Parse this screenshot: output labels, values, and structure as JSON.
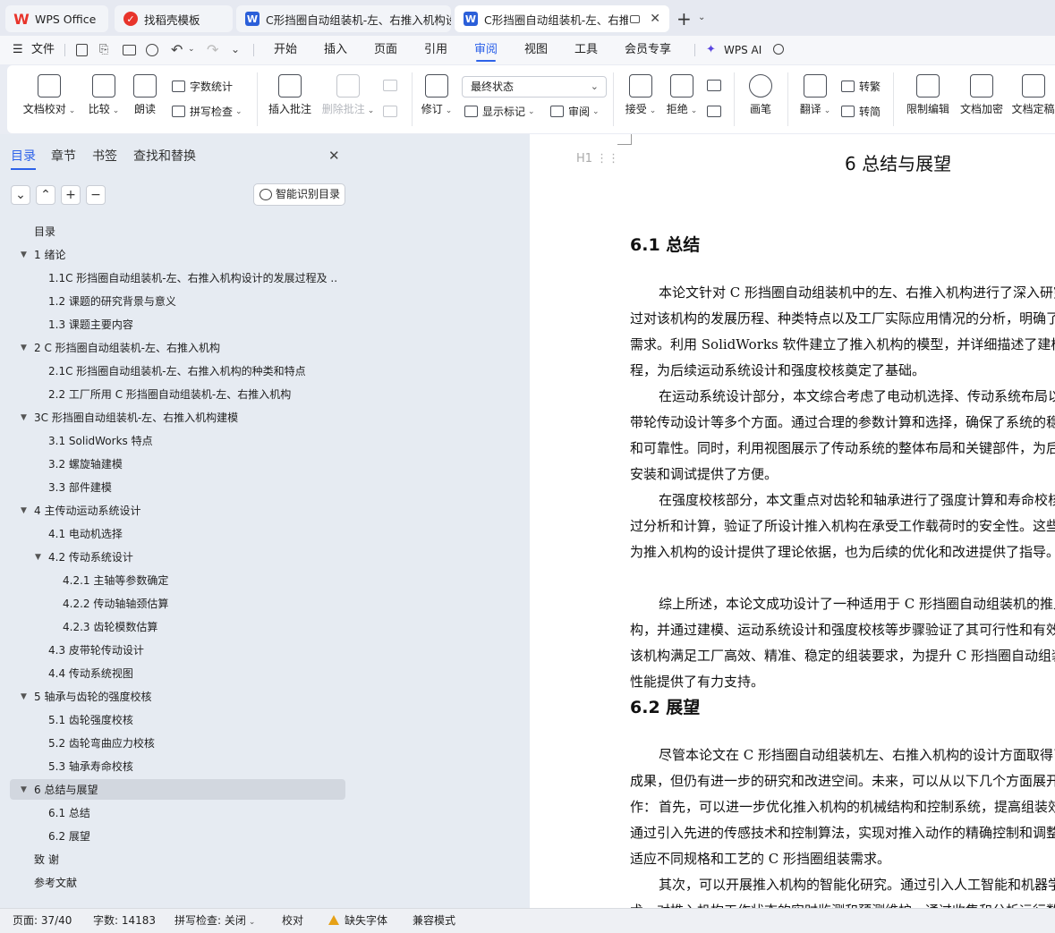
{
  "tabs": [
    {
      "label": "WPS Office",
      "icon": "wps-logo-icon"
    },
    {
      "label": "找稻壳模板",
      "icon": "docer-icon"
    },
    {
      "label": "C形挡圈自动组装机-左、右推入机构设",
      "icon": "writer-doc-icon"
    },
    {
      "label": "C形挡圈自动组装机-左、右推入",
      "icon": "writer-doc-icon"
    }
  ],
  "new_tab": "+",
  "menu": {
    "file": "文件",
    "items": [
      "开始",
      "插入",
      "页面",
      "引用",
      "审阅",
      "视图",
      "工具",
      "会员专享"
    ],
    "active": "审阅",
    "wps_ai": "WPS AI"
  },
  "ribbon": {
    "doc_check": "文档校对",
    "compare": "比较",
    "read_aloud": "朗读",
    "word_count": "字数统计",
    "spell_check": "拼写检查",
    "insert_comment": "插入批注",
    "delete_comment": "删除批注",
    "revise": "修订",
    "status_select": "最终状态",
    "show_marks": "显示标记",
    "review": "审阅",
    "accept": "接受",
    "reject": "拒绝",
    "pen": "画笔",
    "translate": "翻译",
    "to_traditional": "转繁",
    "to_simplified": "转简",
    "restrict_edit": "限制编辑",
    "encrypt": "文档加密",
    "finalize": "文档定稿"
  },
  "panel": {
    "tabs": [
      "目录",
      "章节",
      "书签",
      "查找和替换"
    ],
    "smart_toc": "智能识别目录",
    "toc": [
      {
        "label": "目录",
        "level": 1
      },
      {
        "label": "1   绪论",
        "level": 1,
        "expander": true
      },
      {
        "label": "1.1C 形挡圈自动组装机-左、右推入机构设计的发展过程及 ...",
        "level": 2
      },
      {
        "label": "1.2 课题的研究背景与意义",
        "level": 2
      },
      {
        "label": "1.3 课题主要内容",
        "level": 2
      },
      {
        "label": "2   C 形挡圈自动组装机-左、右推入机构",
        "level": 1,
        "expander": true
      },
      {
        "label": "2.1C 形挡圈自动组装机-左、右推入机构的种类和特点",
        "level": 2
      },
      {
        "label": "2.2 工厂所用 C 形挡圈自动组装机-左、右推入机构",
        "level": 2
      },
      {
        "label": "3C 形挡圈自动组装机-左、右推入机构建模",
        "level": 1,
        "expander": true
      },
      {
        "label": "3.1 SolidWorks 特点",
        "level": 2
      },
      {
        "label": "3.2 螺旋轴建模",
        "level": 2
      },
      {
        "label": "3.3 部件建模",
        "level": 2
      },
      {
        "label": "4   主传动运动系统设计",
        "level": 1,
        "expander": true
      },
      {
        "label": "4.1 电动机选择",
        "level": 2
      },
      {
        "label": "4.2 传动系统设计",
        "level": 2,
        "expander": true
      },
      {
        "label": "4.2.1 主轴等参数确定",
        "level": 3
      },
      {
        "label": "4.2.2 传动轴轴颈估算",
        "level": 3
      },
      {
        "label": "4.2.3 齿轮模数估算",
        "level": 3
      },
      {
        "label": "4.3 皮带轮传动设计",
        "level": 2
      },
      {
        "label": "4.4 传动系统视图",
        "level": 2
      },
      {
        "label": "5  轴承与齿轮的强度校核",
        "level": 1,
        "expander": true
      },
      {
        "label": "5.1 齿轮强度校核",
        "level": 2
      },
      {
        "label": "5.2 齿轮弯曲应力校核",
        "level": 2
      },
      {
        "label": "5.3 轴承寿命校核",
        "level": 2
      },
      {
        "label": "6 总结与展望",
        "level": 1,
        "expander": true,
        "selected": true
      },
      {
        "label": "6.1 总结",
        "level": 2
      },
      {
        "label": "6.2 展望",
        "level": 2
      },
      {
        "label": "致   谢",
        "level": 1
      },
      {
        "label": "参考文献",
        "level": 1
      }
    ]
  },
  "document": {
    "heading_marker": "H1",
    "title": "6 总结与展望",
    "s1_title": "6.1 总结",
    "s1_paras": [
      "本论文针对 C 形挡圈自动组装机中的左、右推入机构进行了深入研究。通过对该机构的发展历程、种类特点以及工厂实际应用情况的分析，明确了设计需求。利用 SolidWorks 软件建立了推入机构的模型，并详细描述了建模过程，为后续运动系统设计和强度校核奠定了基础。",
      "在运动系统设计部分，本文综合考虑了电动机选择、传动系统布局以及皮带轮传动设计等多个方面。通过合理的参数计算和选择，确保了系统的稳定性和可靠性。同时，利用视图展示了传动系统的整体布局和关键部件，为后续的安装和调试提供了方便。",
      "在强度校核部分，本文重点对齿轮和轴承进行了强度计算和寿命校核。通过分析和计算，验证了所设计推入机构在承受工作载荷时的安全性。这些结果为推入机构的设计提供了理论依据，也为后续的优化和改进提供了指导。",
      "综上所述，本论文成功设计了一种适用于 C 形挡圈自动组装机的推入机构，并通过建模、运动系统设计和强度校核等步骤验证了其可行性和有效性。该机构满足工厂高效、精准、稳定的组装要求，为提升 C 形挡圈自动组装机的性能提供了有力支持。"
    ],
    "s2_title": "6.2 展望",
    "s2_paras": [
      "尽管本论文在 C 形挡圈自动组装机左、右推入机构的设计方面取得了一定成果，但仍有进一步的研究和改进空间。未来，可以从以下几个方面展开工作：",
      "首先，可以进一步优化推入机构的机械结构和控制系统，提高组装效率。通过引入先进的传感技术和控制算法，实现对推入动作的精确控制和调整，以适应不同规格和工艺的 C 形挡圈组装需求。",
      "其次，可以开展推入机构的智能化研究。通过引入人工智能和机器学习技术，对推入机构工作状态的实时监测和预测维护，通过收集和分析运行数据"
    ]
  },
  "status": {
    "page": "页面: 37/40",
    "words": "字数: 14183",
    "spell": "拼写检查: 关闭",
    "proof": "校对",
    "missing_font": "缺失字体",
    "compat": "兼容模式"
  },
  "colors": {
    "accent": "#2d62e9",
    "wps_red": "#e8342b",
    "doc_blue": "#2b5fd9"
  }
}
